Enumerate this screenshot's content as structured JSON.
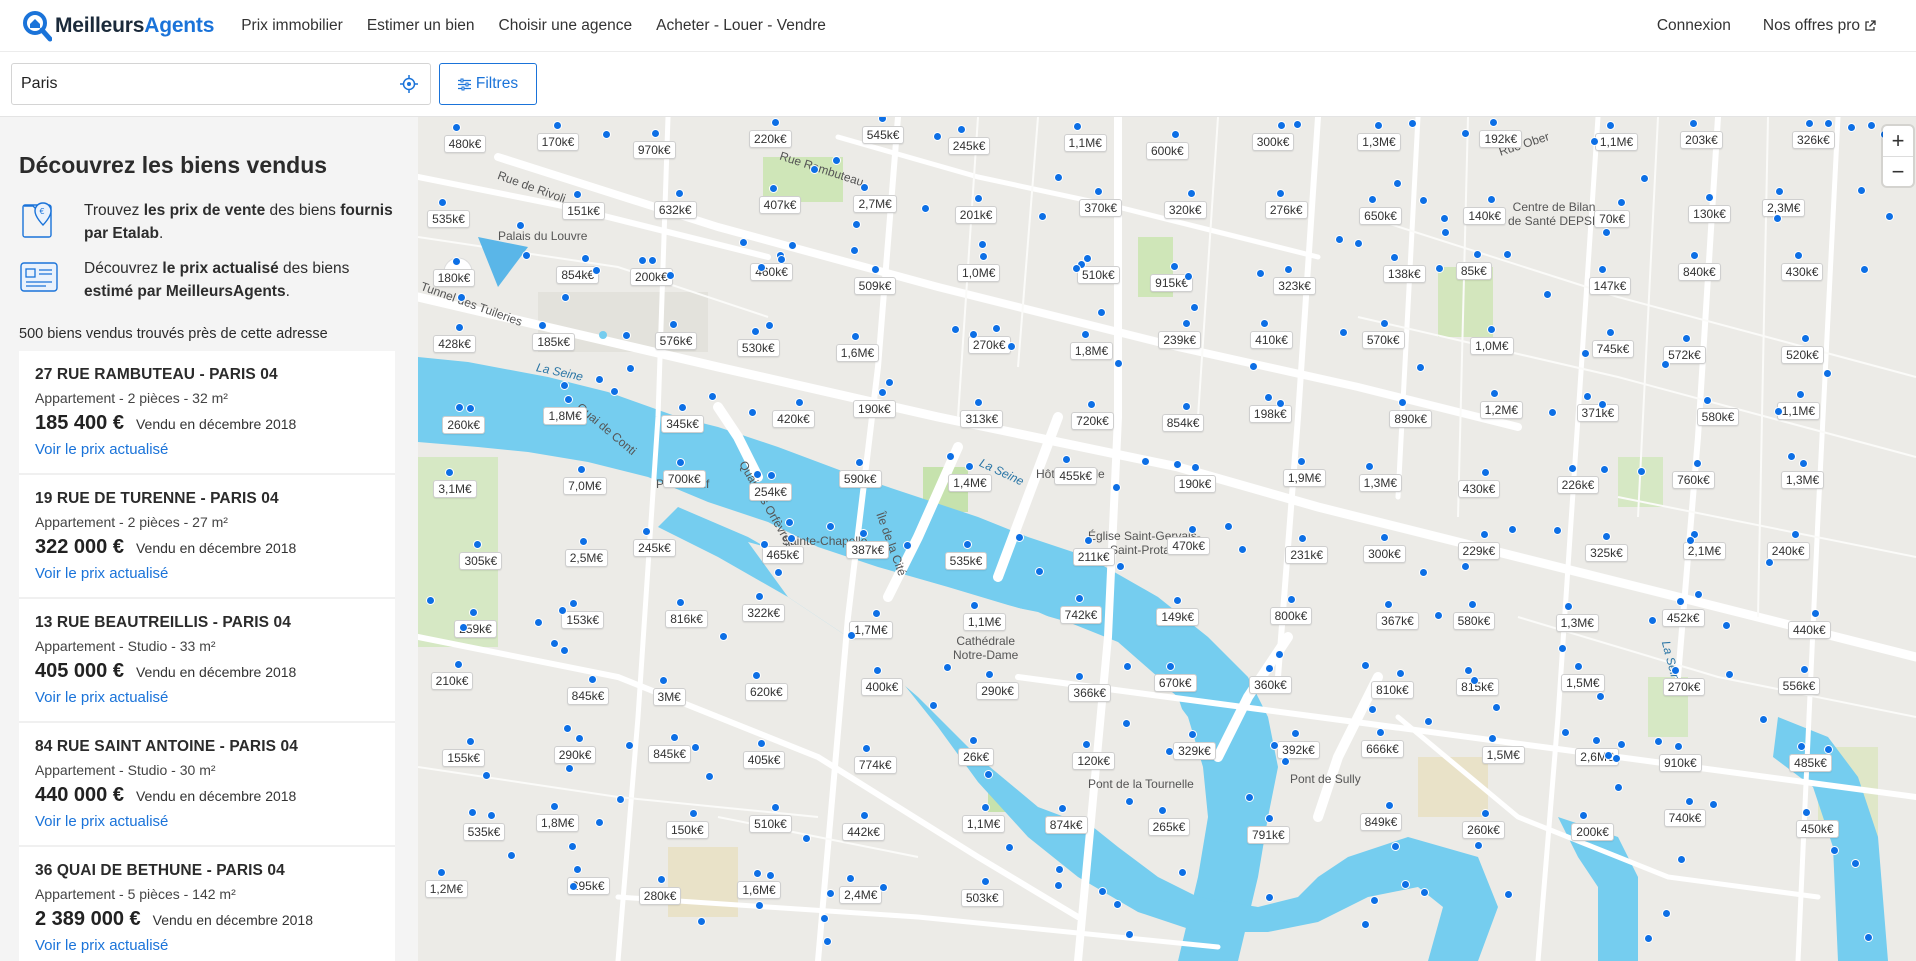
{
  "header": {
    "logo_part1": "Meilleurs",
    "logo_part2": "Agents",
    "nav": [
      "Prix immobilier",
      "Estimer un bien",
      "Choisir une agence",
      "Acheter - Louer - Vendre"
    ],
    "login": "Connexion",
    "offers": "Nos offres pro"
  },
  "search": {
    "value": "Paris",
    "filters_label": "Filtres"
  },
  "sidebar": {
    "title": "Découvrez les biens vendus",
    "info1": {
      "t1": "Trouvez ",
      "b1": "les prix de vente",
      "t2": " des biens ",
      "b2": "fournis par Etalab",
      "t3": "."
    },
    "info2": {
      "t1": "Découvrez ",
      "b1": "le prix actualisé",
      "t2": " des biens ",
      "b2": "estimé par MeilleursAgents",
      "t3": "."
    },
    "count": "500 biens vendus trouvés près de cette adresse",
    "link_label": "Voir le prix actualisé",
    "items": [
      {
        "addr": "27 RUE RAMBUTEAU - PARIS 04",
        "desc": "Appartement - 2 pièces - 32 m²",
        "price": "185 400 €",
        "sold": "Vendu en décembre 2018"
      },
      {
        "addr": "19 RUE DE TURENNE - PARIS 04",
        "desc": "Appartement - 2 pièces - 27 m²",
        "price": "322 000 €",
        "sold": "Vendu en décembre 2018"
      },
      {
        "addr": "13 RUE BEAUTREILLIS - PARIS 04",
        "desc": "Appartement - Studio - 33 m²",
        "price": "405 000 €",
        "sold": "Vendu en décembre 2018"
      },
      {
        "addr": "84 RUE SAINT ANTOINE - PARIS 04",
        "desc": "Appartement - Studio - 30 m²",
        "price": "440 000 €",
        "sold": "Vendu en décembre 2018"
      },
      {
        "addr": "36 QUAI DE BETHUNE - PARIS 04",
        "desc": "Appartement - 5 pièces - 142 m²",
        "price": "2 389 000 €",
        "sold": "Vendu en décembre 2018"
      }
    ]
  },
  "map": {
    "places": [
      "Palais du Louvre",
      "Pont Neuf",
      "Sainte-Chapelle",
      "Hôtel de ville",
      "Église Saint-Gervais-\nSaint-Protais",
      "Cathédrale\nNotre-Dame",
      "Pont de la Tournelle",
      "Pont de Sully",
      "Centre de Bilan\nde Santé DEPSE"
    ],
    "streets": [
      "Rue de Rivoli",
      "Rue Rambuteau",
      "Tunnel des Tuileries",
      "Quai de Conti",
      "Quai des Orfèvres",
      "Île de la Cité",
      "Rue Ober"
    ],
    "river": "La Seine",
    "zoom_in": "+",
    "zoom_out": "−",
    "prices": [
      "480k€",
      "170k€",
      "970k€",
      "220k€",
      "545k€",
      "245k€",
      "1,1M€",
      "600k€",
      "300k€",
      "1,3M€",
      "192k€",
      "1,1M€",
      "203k€",
      "326k€",
      "535k€",
      "151k€",
      "632k€",
      "407k€",
      "2,7M€",
      "201k€",
      "370k€",
      "320k€",
      "276k€",
      "650k€",
      "140k€",
      "70k€",
      "130k€",
      "2,3M€",
      "180k€",
      "854k€",
      "200k€",
      "460k€",
      "509k€",
      "1,0M€",
      "510k€",
      "915k€",
      "323k€",
      "138k€",
      "85k€",
      "147k€",
      "840k€",
      "430k€",
      "428k€",
      "185k€",
      "576k€",
      "530k€",
      "1,6M€",
      "270k€",
      "1,8M€",
      "239k€",
      "410k€",
      "570k€",
      "1,0M€",
      "745k€",
      "572k€",
      "520k€",
      "260k€",
      "1,8M€",
      "345k€",
      "420k€",
      "190k€",
      "313k€",
      "720k€",
      "854k€",
      "198k€",
      "890k€",
      "1,2M€",
      "371k€",
      "580k€",
      "1,1M€",
      "3,1M€",
      "7,0M€",
      "700k€",
      "254k€",
      "590k€",
      "1,4M€",
      "455k€",
      "190k€",
      "1,9M€",
      "1,3M€",
      "430k€",
      "226k€",
      "760k€",
      "1,3M€",
      "305k€",
      "2,5M€",
      "245k€",
      "465k€",
      "387k€",
      "535k€",
      "211k€",
      "470k€",
      "231k€",
      "300k€",
      "229k€",
      "325k€",
      "2,1M€",
      "240k€",
      "259k€",
      "153k€",
      "816k€",
      "322k€",
      "1,7M€",
      "1,1M€",
      "742k€",
      "149k€",
      "800k€",
      "367k€",
      "580k€",
      "1,3M€",
      "452k€",
      "440k€",
      "210k€",
      "845k€",
      "3M€",
      "620k€",
      "400k€",
      "290k€",
      "366k€",
      "670k€",
      "360k€",
      "810k€",
      "815k€",
      "1,5M€",
      "270k€",
      "556k€",
      "155k€",
      "290k€",
      "845k€",
      "405k€",
      "774k€",
      "26k€",
      "120k€",
      "329k€",
      "392k€",
      "666k€",
      "1,5M€",
      "2,6M€",
      "910k€",
      "485k€",
      "535k€",
      "1,8M€",
      "150k€",
      "510k€",
      "442k€",
      "1,1M€",
      "874k€",
      "265k€",
      "791k€",
      "849k€",
      "260k€",
      "200k€",
      "740k€",
      "450k€",
      "1,2M€",
      "295k€",
      "280k€",
      "1,6M€",
      "2,4M€",
      "503k€"
    ]
  }
}
